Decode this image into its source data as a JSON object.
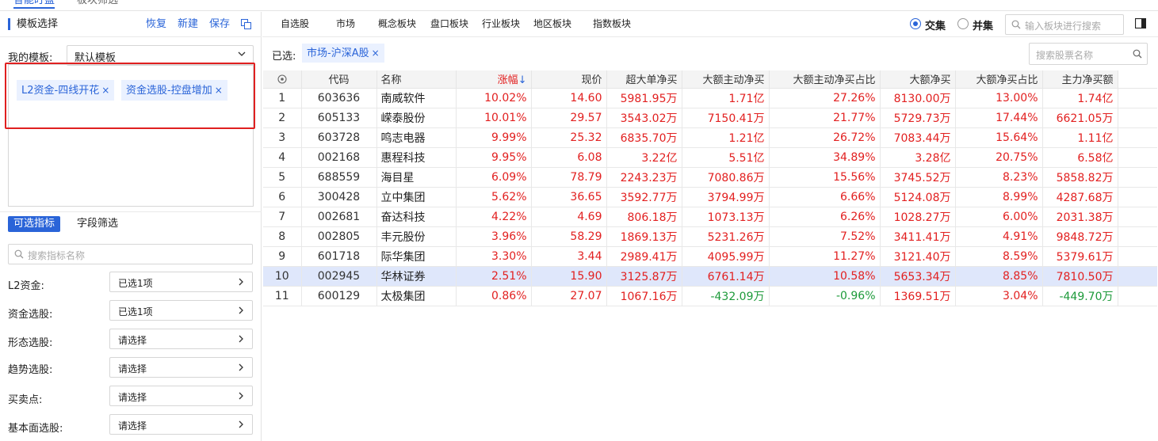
{
  "top_nav": {
    "items": [
      "智能盯盘",
      "板块筛选"
    ]
  },
  "left": {
    "title": "模板选择",
    "actions": {
      "restore": "恢复",
      "new": "新建",
      "save": "保存"
    },
    "my_template_label": "我的模板:",
    "my_template_value": "默认模板",
    "tags": [
      "L2资金-四线开花",
      "资金选股-控盘增加"
    ],
    "tabs": {
      "indicators": "可选指标",
      "field_filter": "字段筛选"
    },
    "indicator_search_placeholder": "搜索指标名称",
    "filters": [
      {
        "label": "L2资金:",
        "value": "已选1项"
      },
      {
        "label": "资金选股:",
        "value": "已选1项"
      },
      {
        "label": "形态选股:",
        "value": "请选择"
      },
      {
        "label": "趋势选股:",
        "value": "请选择"
      },
      {
        "label": "买卖点:",
        "value": "请选择"
      },
      {
        "label": "基本面选股:",
        "value": "请选择"
      }
    ]
  },
  "right": {
    "tabs": [
      "自选股",
      "市场",
      "概念板块",
      "盘口板块",
      "行业板块",
      "地区板块",
      "指数板块"
    ],
    "mode": {
      "intersection": "交集",
      "union": "并集",
      "selected": "intersection"
    },
    "block_search_placeholder": "输入板块进行搜索",
    "selected_label": "已选:",
    "selected_tag": "市场-沪深A股",
    "stock_search_placeholder": "搜索股票名称"
  },
  "table": {
    "columns": [
      "代码",
      "名称",
      "涨幅",
      "现价",
      "超大单净买",
      "大额主动净买",
      "大额主动净买占比",
      "大额净买",
      "大额净买占比",
      "主力净买额"
    ],
    "sort_column": "涨幅",
    "sort_direction": "desc",
    "rows": [
      {
        "idx": "1",
        "code": "603636",
        "name": "南威软件",
        "chg": "10.02%",
        "price": "14.60",
        "super": "5981.95万",
        "active": "1.71亿",
        "active_pct": "27.26%",
        "big": "8130.00万",
        "big_pct": "13.00%",
        "main": "1.74亿",
        "name_red": false
      },
      {
        "idx": "2",
        "code": "605133",
        "name": "嵘泰股份",
        "chg": "10.01%",
        "price": "29.57",
        "super": "3543.02万",
        "active": "7150.41万",
        "active_pct": "21.77%",
        "big": "5729.73万",
        "big_pct": "17.44%",
        "main": "6621.05万",
        "name_red": false
      },
      {
        "idx": "3",
        "code": "603728",
        "name": "鸣志电器",
        "chg": "9.99%",
        "price": "25.32",
        "super": "6835.70万",
        "active": "1.21亿",
        "active_pct": "26.72%",
        "big": "7083.44万",
        "big_pct": "15.64%",
        "main": "1.11亿",
        "name_red": true
      },
      {
        "idx": "4",
        "code": "002168",
        "name": "惠程科技",
        "chg": "9.95%",
        "price": "6.08",
        "super": "3.22亿",
        "active": "5.51亿",
        "active_pct": "34.89%",
        "big": "3.28亿",
        "big_pct": "20.75%",
        "main": "6.58亿",
        "name_red": false
      },
      {
        "idx": "5",
        "code": "688559",
        "name": "海目星",
        "chg": "6.09%",
        "price": "78.79",
        "super": "2243.23万",
        "active": "7080.86万",
        "active_pct": "15.56%",
        "big": "3745.52万",
        "big_pct": "8.23%",
        "main": "5858.82万",
        "name_red": false
      },
      {
        "idx": "6",
        "code": "300428",
        "name": "立中集团",
        "chg": "5.62%",
        "price": "36.65",
        "super": "3592.77万",
        "active": "3794.99万",
        "active_pct": "6.66%",
        "big": "5124.08万",
        "big_pct": "8.99%",
        "main": "4287.68万",
        "name_red": false
      },
      {
        "idx": "7",
        "code": "002681",
        "name": "奋达科技",
        "chg": "4.22%",
        "price": "4.69",
        "super": "806.18万",
        "active": "1073.13万",
        "active_pct": "6.26%",
        "big": "1028.27万",
        "big_pct": "6.00%",
        "main": "2031.38万",
        "name_red": false
      },
      {
        "idx": "8",
        "code": "002805",
        "name": "丰元股份",
        "chg": "3.96%",
        "price": "58.29",
        "super": "1869.13万",
        "active": "5231.26万",
        "active_pct": "7.52%",
        "big": "3411.41万",
        "big_pct": "4.91%",
        "main": "9848.72万",
        "name_red": false
      },
      {
        "idx": "9",
        "code": "601718",
        "name": "际华集团",
        "chg": "3.30%",
        "price": "3.44",
        "super": "2989.41万",
        "active": "4095.99万",
        "active_pct": "11.27%",
        "big": "3121.40万",
        "big_pct": "8.59%",
        "main": "5379.61万",
        "name_red": false
      },
      {
        "idx": "10",
        "code": "002945",
        "name": "华林证券",
        "chg": "2.51%",
        "price": "15.90",
        "super": "3125.87万",
        "active": "6761.14万",
        "active_pct": "10.58%",
        "big": "5653.34万",
        "big_pct": "8.85%",
        "main": "7810.50万",
        "name_red": false,
        "selected": true
      },
      {
        "idx": "11",
        "code": "600129",
        "name": "太极集团",
        "chg": "0.86%",
        "price": "27.07",
        "super": "1067.16万",
        "active": "-432.09万",
        "active_pct": "-0.96%",
        "big": "1369.51万",
        "big_pct": "3.04%",
        "main": "-449.70万",
        "name_red": false
      }
    ]
  },
  "colors": {
    "accent": "#2a64d8",
    "up": "#e22020",
    "down": "#1d9a3a",
    "highlight": "#e02020",
    "selected_row": "#dfe7fb"
  }
}
